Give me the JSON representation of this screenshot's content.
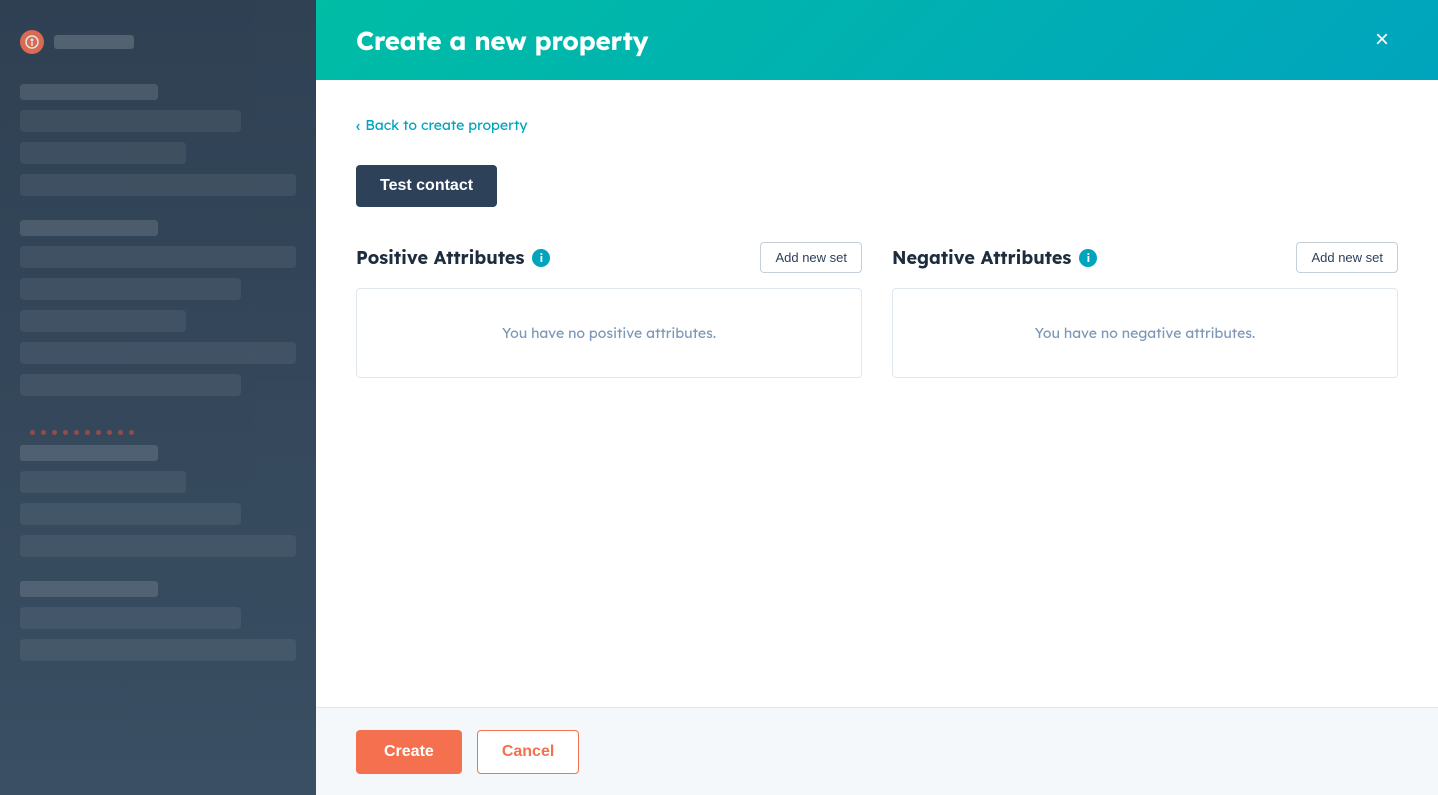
{
  "modal": {
    "title": "Create a new property",
    "close_label": "×",
    "back_link": "Back to create property",
    "test_contact_label": "Test contact",
    "positive_attributes": {
      "title": "Positive Attributes",
      "add_button": "Add new set",
      "empty_text": "You have no positive attributes."
    },
    "negative_attributes": {
      "title": "Negative Attributes",
      "add_button": "Add new set",
      "empty_text": "You have no negative attributes."
    },
    "footer": {
      "create_label": "Create",
      "cancel_label": "Cancel"
    }
  },
  "colors": {
    "teal_gradient_start": "#00bda5",
    "teal_gradient_end": "#00a4bd",
    "sidebar_bg": "#2d3e50",
    "create_btn": "#f4704f",
    "dark_blue": "#2d4159"
  }
}
